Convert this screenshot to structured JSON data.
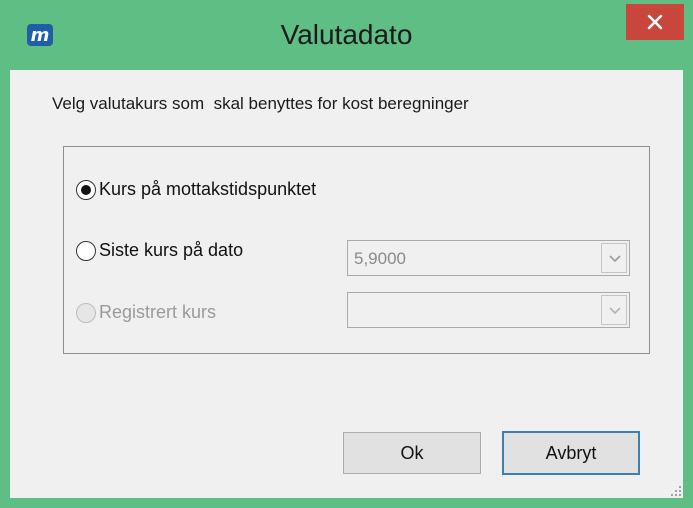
{
  "window": {
    "title": "Valutadato",
    "app_icon_letter": "m",
    "close_glyph": "×"
  },
  "dialog": {
    "prompt": "Velg valutakurs som  skal benyttes for kost beregninger",
    "options": [
      {
        "label": "Kurs på mottakstidspunktet",
        "selected": true,
        "enabled": true
      },
      {
        "label": "Siste kurs på dato",
        "selected": false,
        "enabled": true
      },
      {
        "label": "Registrert kurs",
        "selected": false,
        "enabled": false
      }
    ],
    "date_rate_combo": {
      "value": "5,9000",
      "enabled": false
    },
    "registered_rate_combo": {
      "value": "",
      "enabled": false
    },
    "ok_label": "Ok",
    "cancel_label": "Avbryt"
  },
  "colors": {
    "frame": "#5ebe84",
    "close_button": "#c9463d",
    "default_button_border": "#3c7fb1"
  }
}
